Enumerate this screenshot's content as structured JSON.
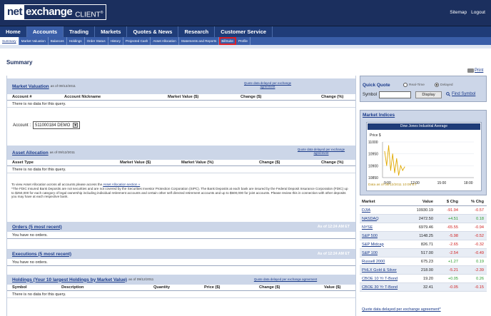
{
  "header": {
    "logo_net": "net",
    "logo_exchange": "exchange",
    "logo_client": "CLIENT",
    "logo_tm": "®",
    "sitemap": "Sitemap",
    "logout": "Logout"
  },
  "nav": [
    "Home",
    "Accounts",
    "Trading",
    "Markets",
    "Quotes & News",
    "Research",
    "Customer Service"
  ],
  "subnav": [
    "Summary",
    "Market Valuation",
    "Balances",
    "Holdings",
    "Order Status",
    "History",
    "Projected Cash",
    "Asset Allocation",
    "Statements and Reports",
    "BillSuite",
    "Profile"
  ],
  "page_title": "Summary",
  "print_label": "Print",
  "market_valuation": {
    "title": "Market Valuation",
    "asof": "as of 09/12/2011",
    "note": "Quote data delayed per exchange agreement",
    "cols": [
      "Account #",
      "Account Nickname",
      "Market Value ($)",
      "Change ($)",
      "Change (%)"
    ],
    "empty": "There is no data for this query."
  },
  "account": {
    "label": "Account :",
    "value": "511000184  DEMO"
  },
  "asset_allocation": {
    "title": "Asset Allocation",
    "asof": "as of 09/12/2011",
    "note": "Quote data delayed per exchange agreement",
    "cols": [
      "Asset Type",
      "Market Value ($)",
      "Market Value (%)",
      "Change ($)",
      "Change (%)"
    ],
    "empty": "There is no data for this query."
  },
  "disclaimer": {
    "line1": "To view Asset Allocation across all accounts please access the",
    "link": "Asset Allocation section »",
    "body": "*The FDIC Insured Bank Deposits are not securities and are not covered by the Securities Investor Protection Corporation (SIPC). The Bank Deposits at each bank are insured by the Federal Deposit Insurance Corporation (FDIC) up to $250,000 for each category of legal ownership including individual retirement accounts and certain other self directed retirement accounts and up to $500,000 for joint accounts. Please review this in connection with other deposits you may have at each respective bank."
  },
  "orders": {
    "title": "Orders (5 most recent)",
    "asof": "As of 12:24 AM ET",
    "empty": "You have no orders."
  },
  "executions": {
    "title": "Executions (5 most recent)",
    "asof": "As of 12:24 AM ET",
    "empty": "You have no orders."
  },
  "holdings": {
    "title": "Holdings (Your 10 largest Holdings by Market Value)",
    "asof": "as of 09/12/2011",
    "note": "Quote data delayed per exchange agreement",
    "cols": [
      "Symbol",
      "Description",
      "Quantity",
      "Price ($)",
      "Change ($)",
      "Value ($)"
    ],
    "empty": "There is no data for this query."
  },
  "quick_quote": {
    "title": "Quick Quote",
    "opt1": "Real-Time",
    "opt2": "Delayed",
    "symbol_label": "Symbol",
    "button": "Display",
    "find": "Find Symbol"
  },
  "market_indices": {
    "title": "Market Indices",
    "chart_title": "Dow Jones Industrial Average",
    "chart_note": "Data as of 09/12/2011 10:05 ET"
  },
  "chart_data": {
    "type": "line",
    "title": "Dow Jones Industrial Average",
    "ylabel": "Price $",
    "ylim": [
      10850,
      11000
    ],
    "yticks": [
      "11000",
      "10950",
      "10900",
      "10850"
    ],
    "xticks": [
      "9:00",
      "12:00",
      "15:00",
      "18:00"
    ],
    "x": [
      "9:30",
      "9:45",
      "10:00",
      "10:15",
      "10:30",
      "10:45",
      "11:00",
      "11:15",
      "11:30",
      "11:45",
      "12:00"
    ],
    "values": [
      10960,
      10900,
      10985,
      10880,
      10950,
      10870,
      10930,
      10860,
      10900,
      10880,
      10895
    ]
  },
  "market_table": {
    "cols": [
      "Market",
      "Value",
      "$ Chg",
      "% Chg"
    ],
    "rows": [
      [
        "DJIA",
        "10930.19",
        "-91.94",
        "-0.57"
      ],
      [
        "NASDAQ",
        "2472.50",
        "+4.51",
        "0.18"
      ],
      [
        "NYSE",
        "6979.46",
        "-65.55",
        "-0.94"
      ],
      [
        "S&P 500",
        "1148.25",
        "-5.98",
        "-0.52"
      ],
      [
        "S&P Midcap",
        "826.71",
        "-2.65",
        "-0.32"
      ],
      [
        "S&P 100",
        "517.00",
        "-2.54",
        "-0.49"
      ],
      [
        "Russell 2000",
        "675.23",
        "+1.27",
        "0.19"
      ],
      [
        "PHLX Gold & Silver",
        "218.00",
        "-5.21",
        "-2.39"
      ],
      [
        "CBOE 10 Yr T-Bond",
        "19.20",
        "+0.05",
        "0.26"
      ],
      [
        "CBOE 30 Yr T-Bond",
        "32.41",
        "-0.05",
        "-0.15"
      ]
    ]
  },
  "footer_note": "Quote data delayed per exchange agreement*",
  "colors": {
    "navy": "#1b2f5e",
    "nav": "#1f3c78",
    "sub": "#3a5ea8",
    "panel": "#ccd6e8",
    "neg": "#d02020",
    "pos": "#2a9a2a",
    "highlight": "#d8202a"
  }
}
